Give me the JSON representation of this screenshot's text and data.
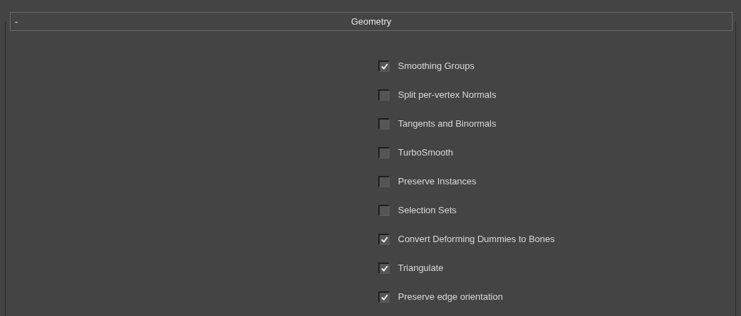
{
  "rollout": {
    "toggle": "-",
    "title": "Geometry"
  },
  "options": [
    {
      "label": "Smoothing Groups",
      "checked": true
    },
    {
      "label": "Split per-vertex Normals",
      "checked": false
    },
    {
      "label": "Tangents and Binormals",
      "checked": false
    },
    {
      "label": "TurboSmooth",
      "checked": false
    },
    {
      "label": "Preserve Instances",
      "checked": false
    },
    {
      "label": "Selection Sets",
      "checked": false
    },
    {
      "label": "Convert Deforming Dummies to Bones",
      "checked": true
    },
    {
      "label": "Triangulate",
      "checked": true
    },
    {
      "label": "Preserve edge orientation",
      "checked": true
    }
  ]
}
